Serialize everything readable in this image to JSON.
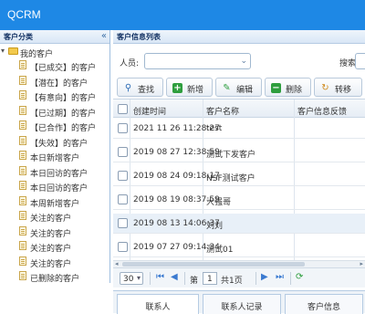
{
  "app": {
    "title": "QCRM"
  },
  "sidebar": {
    "title": "客户分类",
    "collapse_icon": "«",
    "root_label": "我的客户",
    "items": [
      {
        "label": "【已成交】的客户"
      },
      {
        "label": "【潜在】的客户"
      },
      {
        "label": "【有意向】的客户"
      },
      {
        "label": "【已过期】的客户"
      },
      {
        "label": "【已合作】的客户"
      },
      {
        "label": "【失效】的客户"
      },
      {
        "label": "本日新增客户"
      },
      {
        "label": "本日回访的客户"
      },
      {
        "label": "本日回访的客户"
      },
      {
        "label": "本周新增客户"
      },
      {
        "label": "关注的客户"
      },
      {
        "label": "关注的客户"
      },
      {
        "label": "关注的客户"
      },
      {
        "label": "关注的客户"
      },
      {
        "label": "已删除的客户"
      }
    ]
  },
  "main": {
    "title": "客户信息列表",
    "filter": {
      "owner_label": "人员:",
      "owner_value": "",
      "search_label": "搜索:",
      "search_value": ""
    },
    "toolbar": {
      "buttons": [
        {
          "label": "查找",
          "icon": "search-icon"
        },
        {
          "label": "新增",
          "icon": "plus-icon"
        },
        {
          "label": "编辑",
          "icon": "pencil-icon"
        },
        {
          "label": "删除",
          "icon": "minus-icon"
        },
        {
          "label": "转移",
          "icon": "transfer-icon"
        }
      ]
    },
    "grid": {
      "columns": [
        "创建时间",
        "客户名称",
        "客户信息反馈"
      ],
      "rows": [
        {
          "created": "2021 11 26 11:28:27",
          "name": "test",
          "selected": false
        },
        {
          "created": "2019 08 27 12:38:59",
          "name": "测试下发客户",
          "selected": false
        },
        {
          "created": "2019 08 24 09:18:17",
          "name": "NSF测试客户",
          "selected": false
        },
        {
          "created": "2019 08 19 08:37:59",
          "name": "大强哥",
          "selected": false
        },
        {
          "created": "2019 08 13 14:06:37",
          "name": "刘刘",
          "selected": true
        },
        {
          "created": "2019 07 27 09:14:34",
          "name": "测试01",
          "selected": false
        }
      ]
    },
    "pager": {
      "page_size": "30",
      "page_label": "第",
      "page_value": "1",
      "total_label": "共1页"
    },
    "bottom_tabs": [
      {
        "label": "联系人"
      },
      {
        "label": "联系人记录"
      },
      {
        "label": "客户信息"
      }
    ]
  },
  "colors": {
    "topbar": "#1e88e5",
    "panel_border": "#b5cbe3",
    "selected_row": "#e8f0f8"
  }
}
